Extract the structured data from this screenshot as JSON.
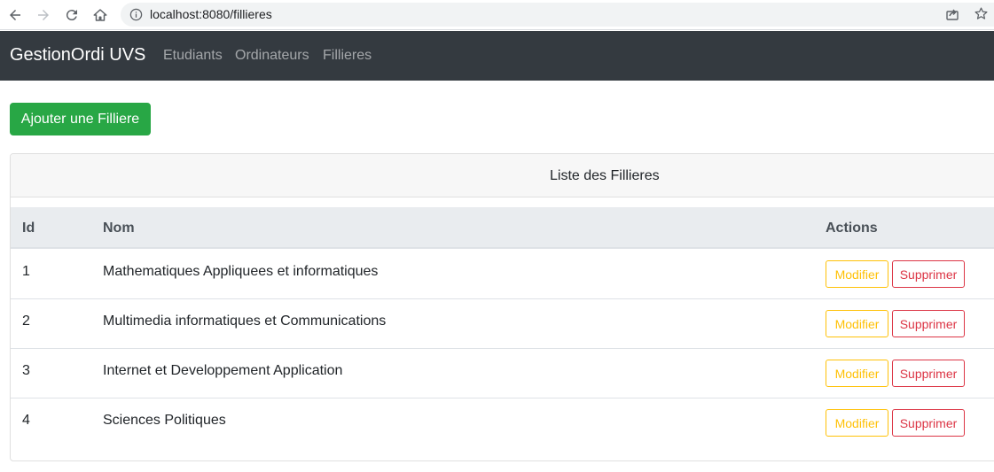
{
  "browser": {
    "url": "localhost:8080/fillieres"
  },
  "navbar": {
    "brand": "GestionOrdi UVS",
    "links": [
      {
        "label": "Etudiants"
      },
      {
        "label": "Ordinateurs"
      },
      {
        "label": "Fillieres"
      }
    ]
  },
  "add_button_label": "Ajouter une Filliere",
  "card": {
    "title": "Liste des Fillieres",
    "columns": [
      "Id",
      "Nom",
      "Actions"
    ],
    "rows": [
      {
        "id": "1",
        "nom": "Mathematiques Appliquees et informatiques"
      },
      {
        "id": "2",
        "nom": "Multimedia informatiques et Communications"
      },
      {
        "id": "3",
        "nom": "Internet et Developpement Application"
      },
      {
        "id": "4",
        "nom": "Sciences Politiques"
      }
    ],
    "edit_label": "Modifier",
    "delete_label": "Supprimer"
  },
  "colors": {
    "navbar": "#343a40",
    "success": "#28a745",
    "warning": "#ffc107",
    "danger": "#dc3545"
  }
}
